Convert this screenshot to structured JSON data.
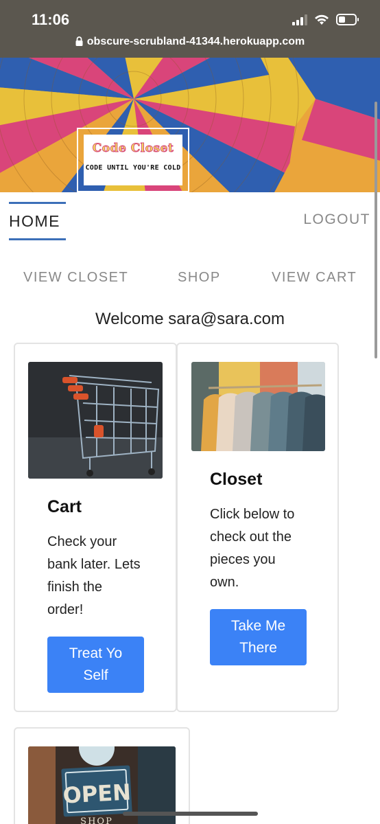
{
  "status_bar": {
    "time": "11:06",
    "icons": [
      "signal-icon",
      "wifi-icon",
      "battery-icon"
    ]
  },
  "browser": {
    "url": "obscure-scrubland-41344.herokuapp.com"
  },
  "brand": {
    "title": "Code Closet",
    "tagline": "CODE UNTIL YOU'RE COLD"
  },
  "nav": {
    "home": "HOME",
    "logout": "LOGOUT",
    "view_closet": "VIEW CLOSET",
    "shop": "SHOP",
    "view_cart": "VIEW CART"
  },
  "welcome": "Welcome sara@sara.com",
  "cards": {
    "cart": {
      "title": "Cart",
      "text_lines": [
        "Check your",
        "bank later. Lets",
        "finish the",
        "order!"
      ],
      "button_lines": [
        "Treat Yo",
        "Self"
      ]
    },
    "closet": {
      "title": "Closet",
      "text_lines": [
        "Click below to",
        "check out the",
        "pieces you",
        "own."
      ],
      "button_lines": [
        "Take Me",
        "There"
      ]
    },
    "shop": {
      "sign_text": "OPEN",
      "sign_sub": "SHOP"
    }
  },
  "colors": {
    "accent": "#3c6fb8",
    "button": "#3b82f6"
  }
}
